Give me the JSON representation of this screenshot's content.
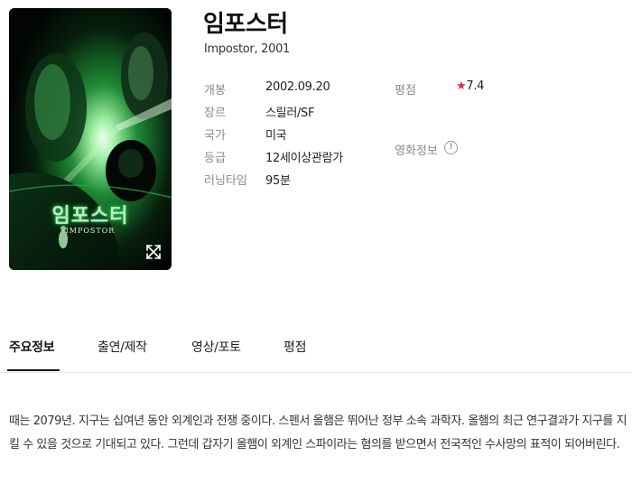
{
  "movie": {
    "title": "임포스터",
    "original_title": "Impostor, 2001",
    "poster_title": "임포스터",
    "poster_subtitle": "IMPOSTOR"
  },
  "details": {
    "release_label": "개봉",
    "release_value": "2002.09.20",
    "genre_label": "장르",
    "genre_value": "스릴러/SF",
    "country_label": "국가",
    "country_value": "미국",
    "rating_label": "등급",
    "rating_value": "12세이상관람가",
    "runtime_label": "러닝타임",
    "runtime_value": "95분",
    "score_label": "평점",
    "score_star": "★",
    "score_value": "7.4",
    "movie_info_label": "영화정보",
    "movie_info_icon": "!"
  },
  "tabs": {
    "main_info": "주요정보",
    "cast_crew": "출연/제작",
    "video_photo": "영상/포토",
    "reviews": "평점"
  },
  "synopsis": {
    "text": "때는 2079년. 지구는 십여년 동안 외계인과 전쟁 중이다. 스펜서 올햄은 뛰어난 정부 소속 과학자. 올햄의 최근 연구결과가 지구를 지킬 수 있을 것으로 기대되고 있다. 그런데 갑자기 올햄이 외계인 스파이라는 혐의를 받으면서 전국적인 수사망의 표적이 되어버린다."
  },
  "colors": {
    "star": "#e5283c",
    "label": "#8a8a8a",
    "poster_glow": "#2fd15a"
  },
  "icons": {
    "expand": "expand-arrows-icon",
    "info": "info-circle-icon"
  }
}
